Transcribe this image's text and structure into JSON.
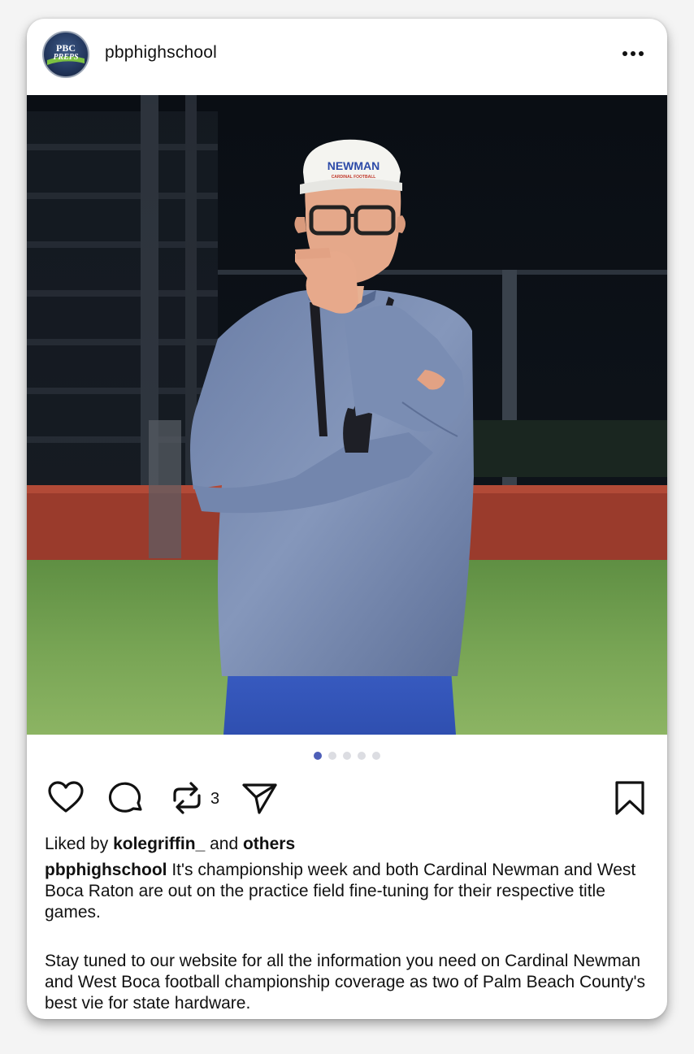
{
  "post": {
    "username": "pbphighschool",
    "avatar_text_top": "PBC",
    "avatar_text_bottom": "PREPS",
    "cap_text_top": "NEWMAN",
    "cap_text_bottom": "CARDINAL FOOTBALL",
    "carousel": {
      "count": 5,
      "active_index": 0
    },
    "repost_count": "3",
    "liked_by_prefix": "Liked by ",
    "liked_by_user": "kolegriffin_",
    "liked_by_conjunction": " and ",
    "liked_by_others": "others",
    "caption_username": "pbphighschool",
    "caption_paragraph_1": " It's championship week and both Cardinal Newman and West Boca Raton are out on the practice field fine-tuning for their respective title games.",
    "caption_paragraph_2": "Stay tuned to our website for all the information you need on Cardinal Newman and West Boca football championship coverage as two of Palm Beach County's best vie for state hardware."
  },
  "icons": {
    "more": "more-horizontal-icon",
    "like": "heart-icon",
    "comment": "comment-bubble-icon",
    "repost": "repost-icon",
    "share": "send-icon",
    "save": "bookmark-icon"
  },
  "colors": {
    "accent": "#4e5fb8",
    "text": "#111111",
    "dot_inactive": "#dcdde2",
    "field_green": "#6c9a4a",
    "track_red": "#9a3b2c"
  }
}
